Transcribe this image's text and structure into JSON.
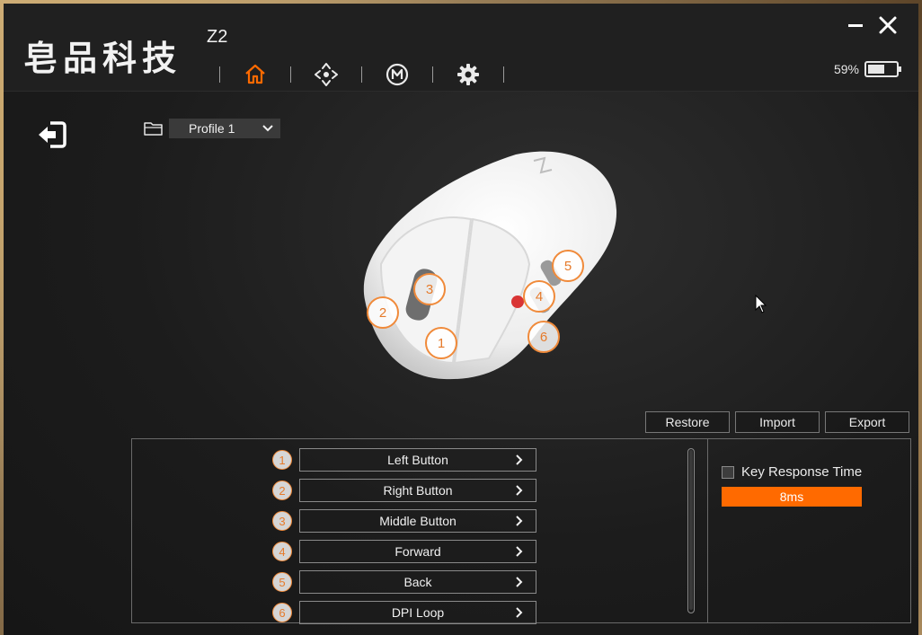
{
  "app": {
    "brand": "皂品科技",
    "model": "Z2"
  },
  "nav": {
    "items": [
      {
        "name": "home-icon",
        "active": true
      },
      {
        "name": "move-icon",
        "active": false
      },
      {
        "name": "macro-icon",
        "active": false
      },
      {
        "name": "gear-icon",
        "active": false
      }
    ],
    "accent": "#ff6a00"
  },
  "battery": {
    "label": "59%",
    "level": 0.59
  },
  "profile": {
    "selected": "Profile 1"
  },
  "hotspots": [
    "1",
    "2",
    "3",
    "4",
    "5",
    "6"
  ],
  "actions": {
    "restore": "Restore",
    "import": "Import",
    "export": "Export"
  },
  "buttons": [
    {
      "num": "1",
      "label": "Left Button"
    },
    {
      "num": "2",
      "label": "Right Button"
    },
    {
      "num": "3",
      "label": "Middle Button"
    },
    {
      "num": "4",
      "label": "Forward"
    },
    {
      "num": "5",
      "label": "Back"
    },
    {
      "num": "6",
      "label": "DPI Loop"
    }
  ],
  "key_response": {
    "label": "Key Response Time",
    "value": "8ms"
  }
}
